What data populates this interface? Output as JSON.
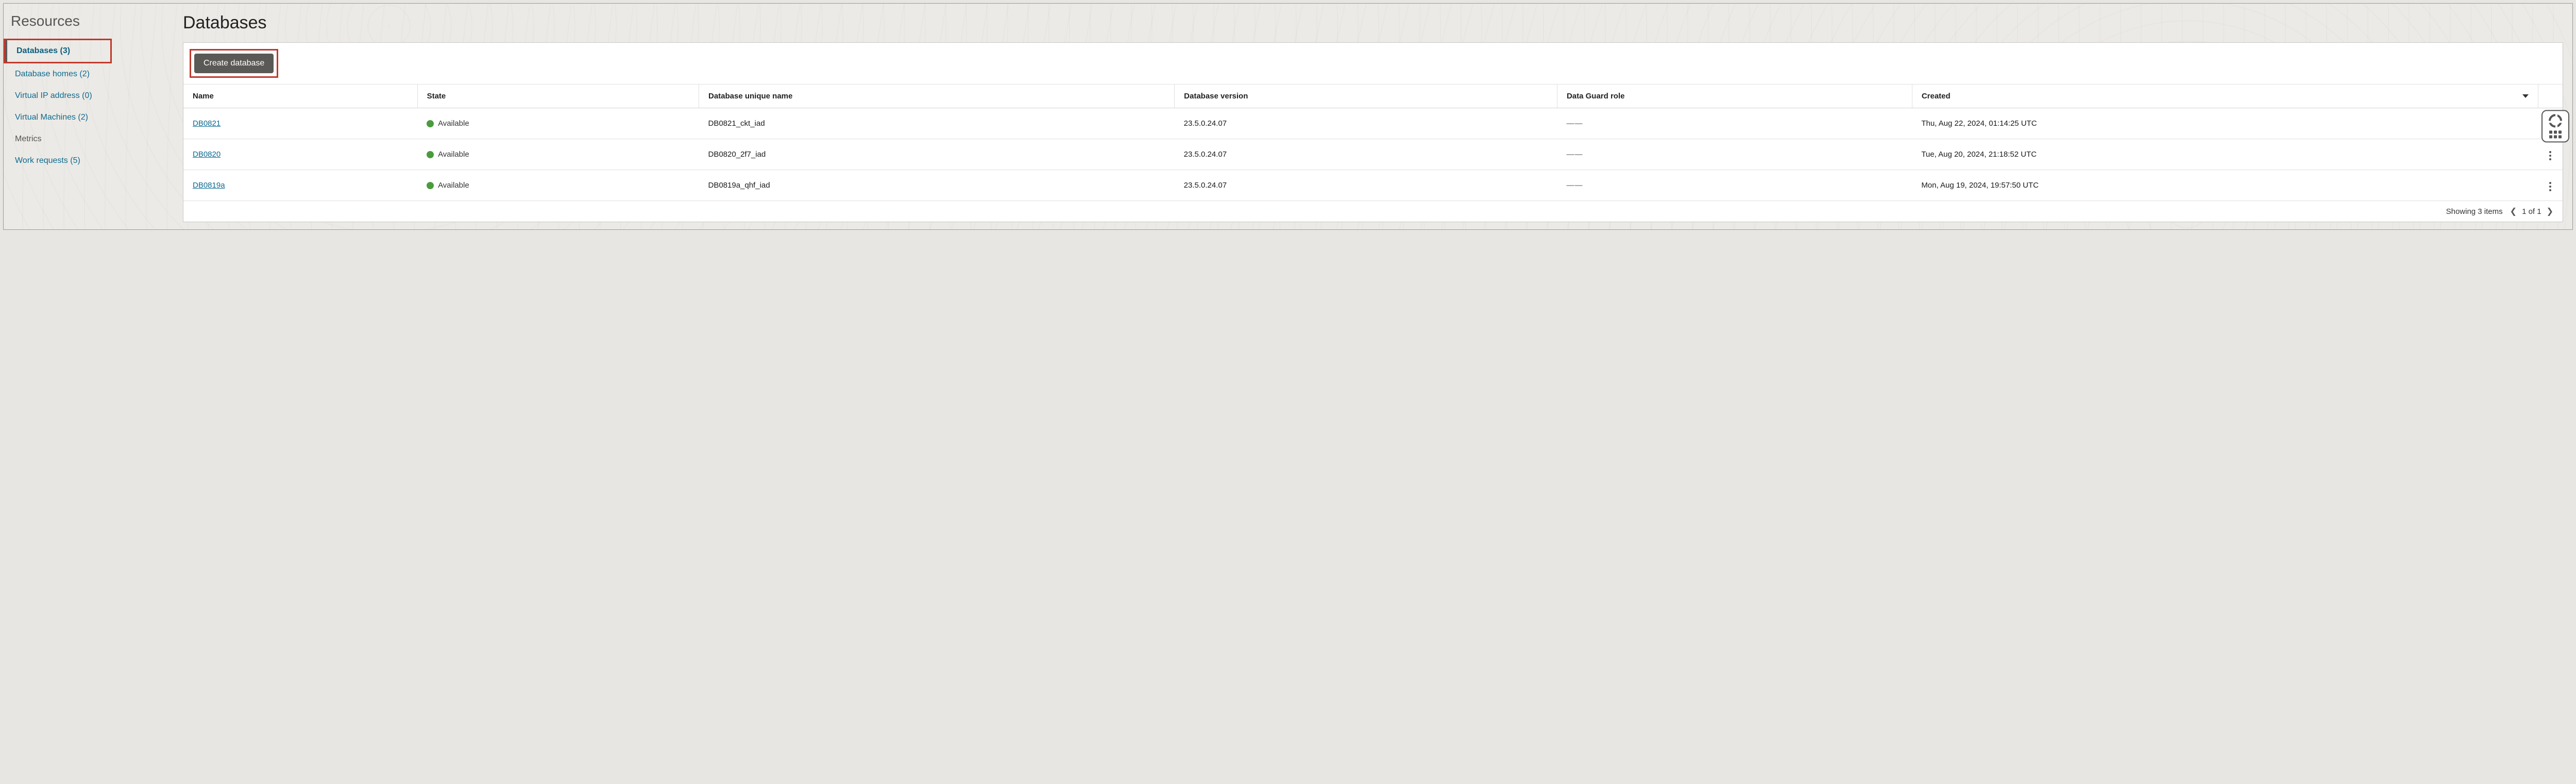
{
  "sidebar": {
    "title": "Resources",
    "items": [
      {
        "label": "Databases (3)",
        "active": true,
        "highlighted": true,
        "muted": false
      },
      {
        "label": "Database homes (2)",
        "active": false,
        "highlighted": false,
        "muted": false
      },
      {
        "label": "Virtual IP address (0)",
        "active": false,
        "highlighted": false,
        "muted": false
      },
      {
        "label": "Virtual Machines (2)",
        "active": false,
        "highlighted": false,
        "muted": false
      },
      {
        "label": "Metrics",
        "active": false,
        "highlighted": false,
        "muted": true
      },
      {
        "label": "Work requests (5)",
        "active": false,
        "highlighted": false,
        "muted": false
      }
    ]
  },
  "page": {
    "title": "Databases",
    "create_button": "Create database"
  },
  "table": {
    "columns": {
      "name": "Name",
      "state": "State",
      "unique_name": "Database unique name",
      "version": "Database version",
      "dg_role": "Data Guard role",
      "created": "Created"
    },
    "rows": [
      {
        "name": "DB0821",
        "state": "Available",
        "unique_name": "DB0821_ckt_iad",
        "version": "23.5.0.24.07",
        "dg_role": "—",
        "created": "Thu, Aug 22, 2024, 01:14:25 UTC"
      },
      {
        "name": "DB0820",
        "state": "Available",
        "unique_name": "DB0820_2f7_iad",
        "version": "23.5.0.24.07",
        "dg_role": "—",
        "created": "Tue, Aug 20, 2024, 21:18:52 UTC"
      },
      {
        "name": "DB0819a",
        "state": "Available",
        "unique_name": "DB0819a_qhf_iad",
        "version": "23.5.0.24.07",
        "dg_role": "—",
        "created": "Mon, Aug 19, 2024, 19:57:50 UTC"
      }
    ],
    "footer": {
      "summary": "Showing 3 items",
      "page_indicator": "1 of 1"
    }
  },
  "status_color": "#4b9b3e"
}
